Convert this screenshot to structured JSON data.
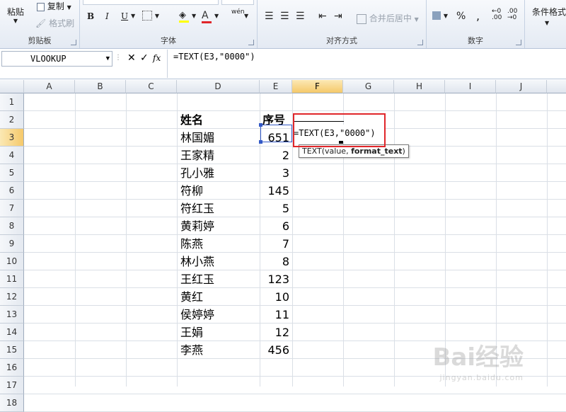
{
  "ribbon": {
    "clipboard": {
      "paste": "粘贴",
      "copy": "复制",
      "format_painter": "格式刷",
      "label": "剪贴板"
    },
    "font": {
      "bold": "B",
      "italic": "I",
      "underline": "U",
      "font_color": "A",
      "phonetic": "wén",
      "label": "字体"
    },
    "alignment": {
      "merge_center": "合并后居中",
      "label": "对齐方式"
    },
    "number": {
      "percent": "%",
      "comma": ",",
      "label": "数字"
    },
    "styles": {
      "conditional_format": "条件格式"
    }
  },
  "formula_bar": {
    "name_box": "VLOOKUP",
    "cancel": "✕",
    "enter": "✓",
    "fx": "fx",
    "formula": "=TEXT(E3,\"0000\")"
  },
  "grid": {
    "columns": [
      "A",
      "B",
      "C",
      "D",
      "E",
      "F",
      "G",
      "H",
      "I",
      "J"
    ],
    "rows": [
      "1",
      "2",
      "3",
      "4",
      "5",
      "6",
      "7",
      "8",
      "9",
      "10",
      "11",
      "12",
      "13",
      "14",
      "15",
      "16",
      "17",
      "18"
    ],
    "header_name": "姓名",
    "header_seq": "序号",
    "records": [
      {
        "name": "林国媚",
        "seq": "651"
      },
      {
        "name": "王家精",
        "seq": "2"
      },
      {
        "name": "孔小雅",
        "seq": "3"
      },
      {
        "name": "符柳",
        "seq": "145"
      },
      {
        "name": "符红玉",
        "seq": "5"
      },
      {
        "name": "黄莉婷",
        "seq": "6"
      },
      {
        "name": "陈燕",
        "seq": "7"
      },
      {
        "name": "林小燕",
        "seq": "8"
      },
      {
        "name": "王红玉",
        "seq": "123"
      },
      {
        "name": "黄红",
        "seq": "10"
      },
      {
        "name": "侯婷婷",
        "seq": "11"
      },
      {
        "name": "王娟",
        "seq": "12"
      },
      {
        "name": "李燕",
        "seq": "456"
      }
    ],
    "editing_cell": "F3",
    "editing_formula": "=TEXT(E3,\"0000\")",
    "tooltip": {
      "arg1": "TEXT(value, ",
      "arg2": "format_text",
      "close": ")"
    }
  },
  "watermark": {
    "logo": "Bai经验",
    "url": "jingyan.baidu.com"
  },
  "colors": {
    "selection": "#3359c6",
    "highlight_box": "#e0262a",
    "header_selected": "#f5c96a"
  }
}
